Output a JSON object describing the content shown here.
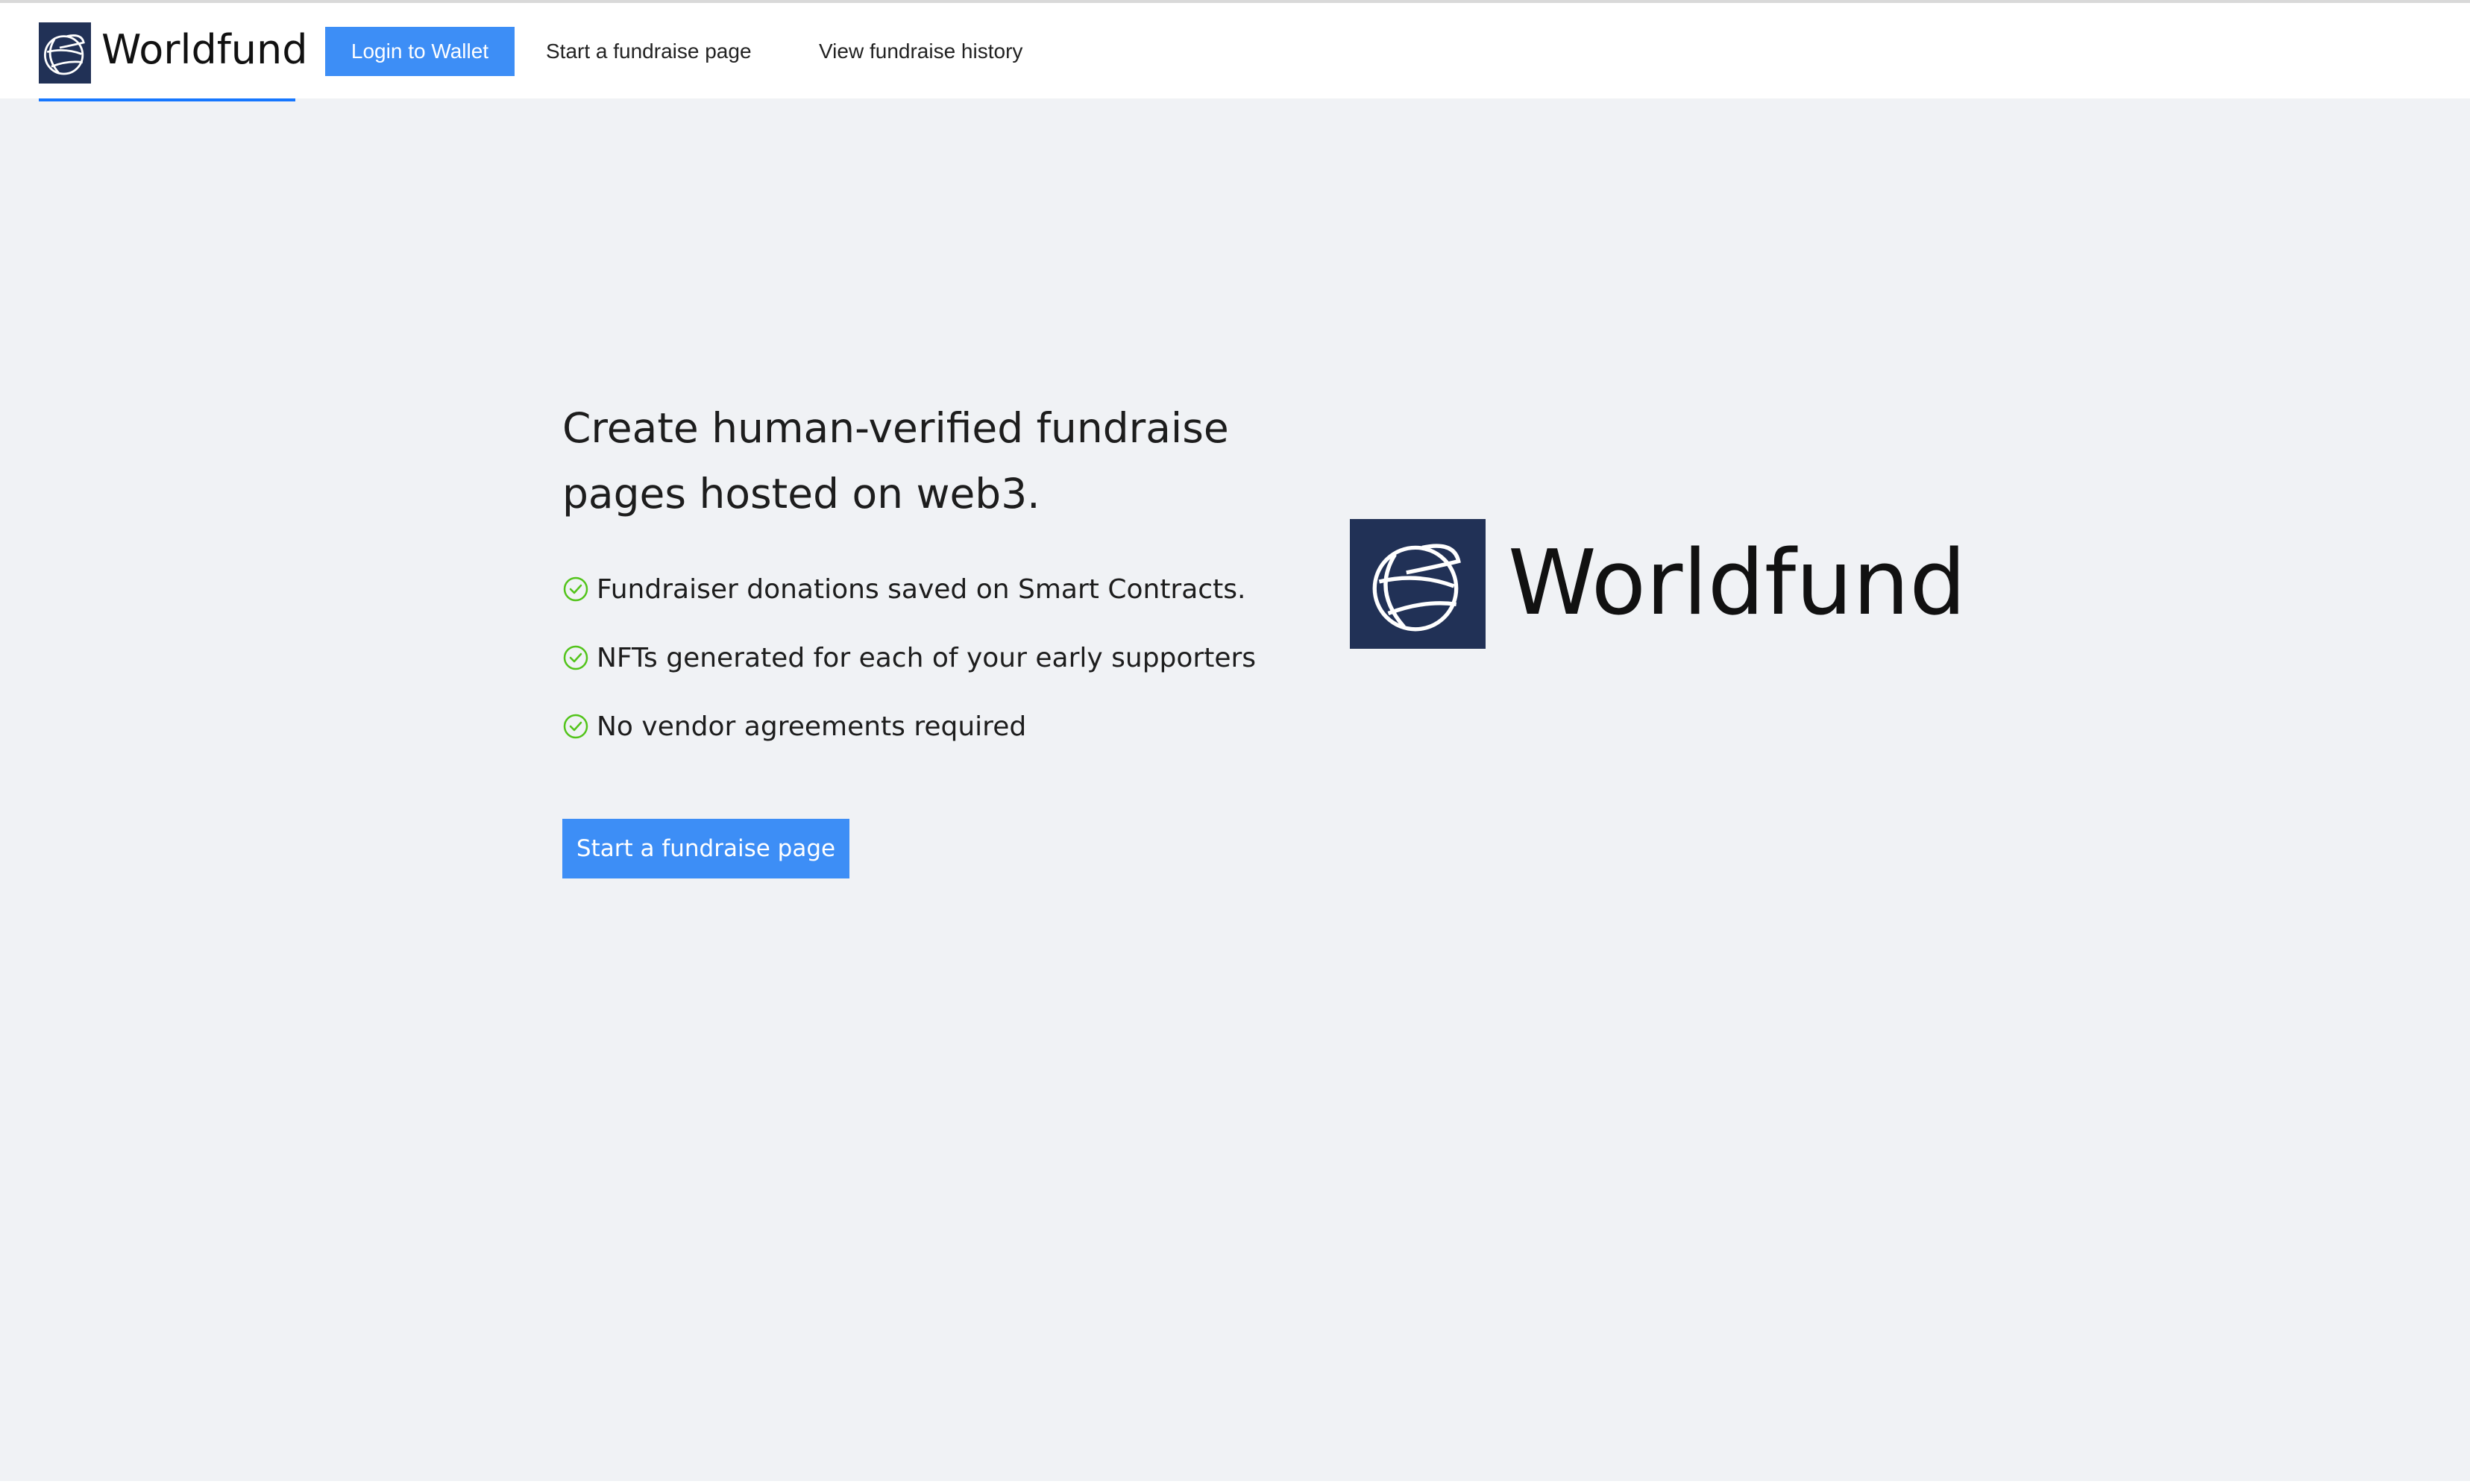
{
  "navbar": {
    "brand": "Worldfund",
    "login_label": "Login to Wallet",
    "links": [
      "Start a fundraise page",
      "View fundraise history"
    ],
    "accent_color": "#1677ff",
    "button_color": "#3d8ef6",
    "logo_bg": "#213156"
  },
  "hero": {
    "title": "Create human-verified fundraise pages hosted on web3.",
    "features": [
      "Fundraiser donations saved on Smart Contracts.",
      "NFTs generated for each of your early supporters",
      "No vendor agreements required"
    ],
    "feature_icon": "check-circle-icon",
    "feature_icon_color": "#52c41a",
    "cta_label": "Start a fundraise page",
    "brand": "Worldfund"
  }
}
